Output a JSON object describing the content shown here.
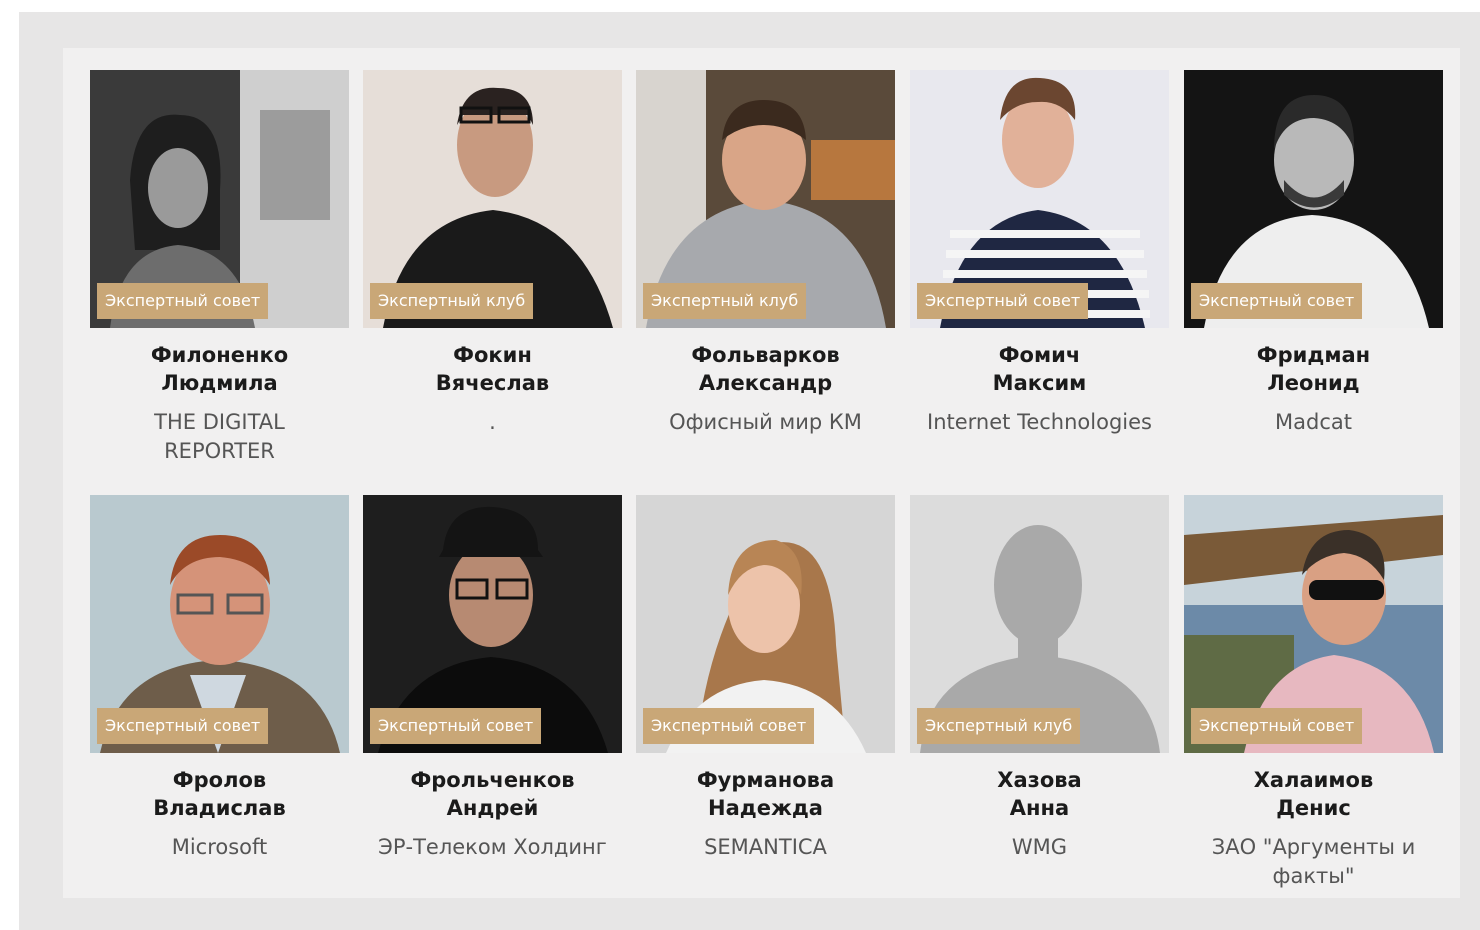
{
  "experts": [
    {
      "badge": "Экспертный совет",
      "last_name": "Филоненко",
      "first_name": "Людмила",
      "company": "THE DIGITAL REPORTER",
      "photo": "woman-portrait-bw"
    },
    {
      "badge": "Экспертный клуб",
      "last_name": "Фокин",
      "first_name": "Вячеслав",
      "company": ".",
      "photo": "man-glasses-black-sweater"
    },
    {
      "badge": "Экспертный клуб",
      "last_name": "Фольварков",
      "first_name": "Александр",
      "company": "Офисный мир КМ",
      "photo": "man-grey-hoodie-office"
    },
    {
      "badge": "Экспертный совет",
      "last_name": "Фомич",
      "first_name": "Максим",
      "company": "Internet Technologies",
      "photo": "man-striped-shirt"
    },
    {
      "badge": "Экспертный совет",
      "last_name": "Фридман",
      "first_name": "Леонид",
      "company": "Madcat",
      "photo": "man-beard-bw"
    },
    {
      "badge": "Экспертный совет",
      "last_name": "Фролов",
      "first_name": "Владислав",
      "company": "Microsoft",
      "photo": "man-glasses-suit"
    },
    {
      "badge": "Экспертный совет",
      "last_name": "Фрольченков",
      "first_name": "Андрей",
      "company": "ЭР-Телеком Холдинг",
      "photo": "man-cap-glasses-dark"
    },
    {
      "badge": "Экспертный совет",
      "last_name": "Фурманова",
      "first_name": "Надежда",
      "company": "SEMANTICA",
      "photo": "woman-long-hair"
    },
    {
      "badge": "Экспертный клуб",
      "last_name": "Хазова",
      "first_name": "Анна",
      "company": "WMG",
      "photo": "placeholder-silhouette"
    },
    {
      "badge": "Экспертный совет",
      "last_name": "Халаимов",
      "first_name": "Денис",
      "company": "ЗАО \"Аргументы и факты\"",
      "photo": "man-sunglasses-outdoor"
    }
  ],
  "colors": {
    "badge_bg": "#c9a777",
    "panel_bg": "#f1f0f0",
    "outer_bg": "#e7e6e6"
  }
}
